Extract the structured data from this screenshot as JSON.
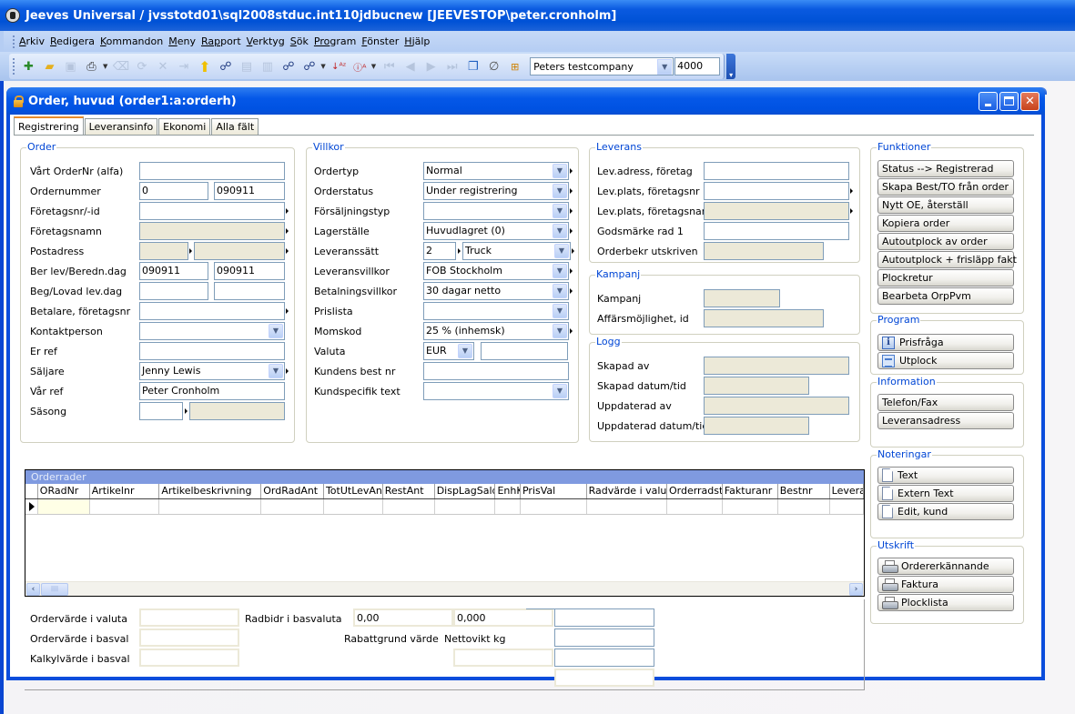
{
  "app": {
    "title": "Jeeves Universal / jvsstotd01\\sql2008stduc.int110jdbucnew [JEEVESTOP\\peter.cronholm]"
  },
  "menu": [
    {
      "label": "Arkiv",
      "accel": "A",
      "rest": "rkiv"
    },
    {
      "label": "Redigera",
      "accel": "R",
      "rest": "edigera"
    },
    {
      "label": "Kommandon",
      "accel": "K",
      "rest": "ommandon"
    },
    {
      "label": "Meny",
      "accel": "M",
      "rest": "eny"
    },
    {
      "label": "Rapport",
      "accel": "Rap",
      "rest": "port"
    },
    {
      "label": "Verktyg",
      "accel": "V",
      "rest": "erktyg"
    },
    {
      "label": "Sök",
      "accel": "S",
      "rest": "ök"
    },
    {
      "label": "Program",
      "accel": "Pro",
      "rest": "gram"
    },
    {
      "label": "Fönster",
      "accel": "F",
      "rest": "önster"
    },
    {
      "label": "Hjälp",
      "accel": "H",
      "rest": "jälp"
    }
  ],
  "toolbar": {
    "company": "Peters testcompany",
    "company_no": "4000",
    "icons": {
      "new": "✚",
      "open": "📁",
      "save": "💾",
      "print": "🖶",
      "erase": "⌫",
      "refresh": "⟳",
      "delete": "✕",
      "export": "⇥",
      "up": "⬆",
      "find": "⚲",
      "filter1": "▤",
      "filter2": "▥",
      "binoc": "⚲",
      "query": "⚲",
      "sort_az": "↓A",
      "sort_info": "ⓘ",
      "first": "⏮",
      "prev": "◀",
      "next": "▶",
      "last": "⏭",
      "windows": "❐",
      "attach": "📎",
      "tree": "⊞"
    }
  },
  "window": {
    "title": "Order, huvud (order1:a:orderh)",
    "tabs": [
      "Registrering",
      "Leveransinfo",
      "Ekonomi",
      "Alla fält"
    ],
    "active_tab": "Registrering"
  },
  "order": {
    "legend": "Order",
    "labels": {
      "vart_ordernr": "Vårt OrderNr (alfa)",
      "ordernummer": "Ordernummer",
      "foretagsnr": "Företagsnr/-id",
      "foretagsnamn": "Företagsnamn",
      "postadress": "Postadress",
      "ber_lev": "Ber lev/Beredn.dag",
      "beg_lovad": "Beg/Lovad lev.dag",
      "betalare": "Betalare, företagsnr",
      "kontaktperson": "Kontaktperson",
      "er_ref": "Er ref",
      "saljare": "Säljare",
      "var_ref": "Vår ref",
      "sasong": "Säsong"
    },
    "values": {
      "vart_ordernr": "",
      "ordernummer": "0",
      "ordernummer_date": "090911",
      "foretagsnr": "",
      "foretagsnamn": "",
      "ber_lev": "090911",
      "beredn_dag": "090911",
      "kontaktperson": "",
      "er_ref": "",
      "saljare": "Jenny Lewis",
      "var_ref": "Peter Cronholm",
      "sasong": ""
    }
  },
  "villkor": {
    "legend": "Villkor",
    "labels": {
      "ordertyp": "Ordertyp",
      "orderstatus": "Orderstatus",
      "forsaljningstyp": "Försäljningstyp",
      "lagerstalle": "Lagerställe",
      "leveranssatt": "Leveranssätt",
      "leveransvillkor": "Leveransvillkor",
      "betalningsvillkor": "Betalningsvillkor",
      "prislista": "Prislista",
      "momskod": "Momskod",
      "valuta": "Valuta",
      "kundens_best_nr": "Kundens best nr",
      "kundspecifik_text": "Kundspecifik text"
    },
    "values": {
      "ordertyp": "Normal",
      "orderstatus": "Under registrering",
      "forsaljningstyp": "",
      "lagerstalle": "Huvudlagret (0)",
      "leveranssatt_code": "2",
      "leveranssatt": "Truck",
      "leveransvillkor": "FOB Stockholm",
      "betalningsvillkor": "30 dagar netto",
      "prislista": "",
      "momskod": "25 % (inhemsk)",
      "valuta": "EUR",
      "kundens_best_nr": "",
      "kundspecifik_text": ""
    }
  },
  "leverans": {
    "legend": "Leverans",
    "labels": {
      "lev_adress": "Lev.adress, företag",
      "lev_plats_nr": "Lev.plats, företagsnr",
      "lev_plats_namn": "Lev.plats, företagsnamn",
      "godsmarke": "Godsmärke rad 1",
      "orderbekr": "Orderbekr utskriven"
    }
  },
  "kampanj": {
    "legend": "Kampanj",
    "labels": {
      "kampanj": "Kampanj",
      "affarsmojlighet": "Affärsmöjlighet, id"
    }
  },
  "logg": {
    "legend": "Logg",
    "labels": {
      "skapad_av": "Skapad av",
      "skapad_datum": "Skapad datum/tid",
      "uppdaterad_av": "Uppdaterad av",
      "uppdaterad_datum": "Uppdaterad datum/tid"
    }
  },
  "funktioner": {
    "legend": "Funktioner",
    "buttons": [
      "Status --> Registrerad",
      "Skapa Best/TO från order",
      "Nytt OE, återställ",
      "Kopiera order",
      "Autoutplock av order",
      "Autoutplock + frisläpp fakt",
      "Plockretur",
      "Bearbeta OrpPvm"
    ]
  },
  "program": {
    "legend": "Program",
    "buttons": [
      {
        "label": "Prisfråga",
        "icon": "info-icon"
      },
      {
        "label": "Utplock",
        "icon": "list-icon"
      }
    ]
  },
  "information": {
    "legend": "Information",
    "buttons": [
      "Telefon/Fax",
      "Leveransadress"
    ]
  },
  "noteringar": {
    "legend": "Noteringar",
    "buttons": [
      "Text",
      "Extern Text",
      "Edit, kund"
    ]
  },
  "utskrift": {
    "legend": "Utskrift",
    "buttons": [
      "Ordererkännande",
      "Faktura",
      "Plocklista"
    ]
  },
  "orderrader": {
    "caption": "Orderrader",
    "columns": [
      "ORadNr",
      "Artikelnr",
      "Artikelbeskrivning",
      "OrdRadAnt",
      "TotUtLevAnt",
      "RestAnt",
      "DispLagSaldo",
      "EnhK",
      "PrisVal",
      "Radvärde i valuta",
      "Orderradsta",
      "Fakturanr",
      "Bestnr",
      "Levera"
    ],
    "rows": [
      [
        "",
        "",
        "",
        "",
        "",
        "",
        "",
        "",
        "",
        "",
        "",
        "",
        "",
        ""
      ]
    ]
  },
  "totals": {
    "ordervarde_valuta": "Ordervärde i valuta",
    "ordervarde_basval": "Ordervärde i basval",
    "kalkylvarde_basval": "Kalkylvärde i basval",
    "radbidr_basvaluta": "Radbidr i basvaluta",
    "rabattgrund_varde": "Rabattgrund värde",
    "nettovikt_kg": "Nettovikt kg",
    "radbidr_value": "0,00",
    "nettovikt_value": "0,000"
  }
}
